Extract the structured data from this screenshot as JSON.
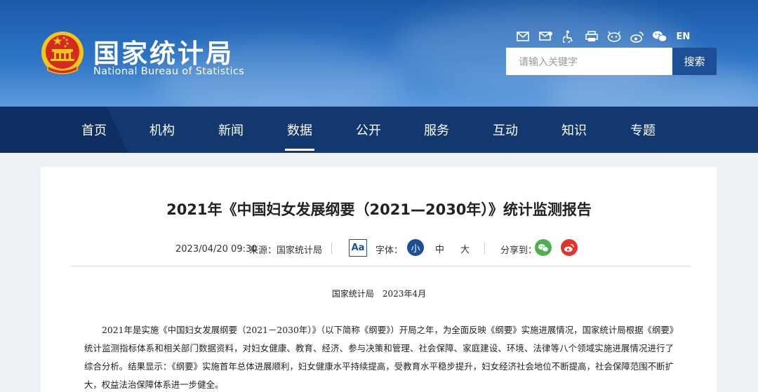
{
  "site": {
    "name_cn": "国家统计局",
    "name_en": "National Bureau of Statistics",
    "lang_switch": "EN",
    "search_placeholder": "请输入关键字",
    "search_button": "搜索",
    "tool_icons": [
      "mail-icon",
      "mail-settings-icon",
      "accessibility-icon",
      "print-icon",
      "mobile-app-icon",
      "weibo-icon",
      "wechat-icon"
    ]
  },
  "nav": {
    "items": [
      "首页",
      "机构",
      "新闻",
      "数据",
      "公开",
      "服务",
      "互动",
      "知识",
      "专题"
    ],
    "active": "数据"
  },
  "article": {
    "title": "2021年《中国妇女发展纲要（2021—2030年）》统计监测报告",
    "date": "2023/04/20 09:30",
    "source": "来源：国家统计局",
    "font_label": "字体：",
    "font_sizes": [
      "小",
      "中",
      "大"
    ],
    "font_size_active": "小",
    "font_toggle": "Aa",
    "share_label": "分享到：",
    "byline": "国家统计局　2023年4月",
    "paragraph": "2021年是实施《中国妇女发展纲要（2021－2030年）》（以下简称《纲要》）开局之年，为全面反映《纲要》实施进展情况，国家统计局根据《纲要》统计监测指标体系和相关部门数据资料，对妇女健康、教育、经济、参与决策和管理、社会保障、家庭建设、环境、法律等八个领域实施进展情况进行了综合分析。结果显示：《纲要》实施首年总体进展顺利，妇女健康水平持续提高，受教育水平稳步提升，妇女经济社会地位不断提高，社会保障范围不断扩大，权益法治保障体系进一步健全。"
  },
  "colors": {
    "header_blue": "#2d74c6",
    "nav_blue": "#13376f",
    "accent_blue": "#1d4f96",
    "wechat_green": "#4caf50",
    "weibo_red": "#e0342d",
    "emblem_red": "#d42a1f",
    "emblem_gold": "#f5c518"
  }
}
